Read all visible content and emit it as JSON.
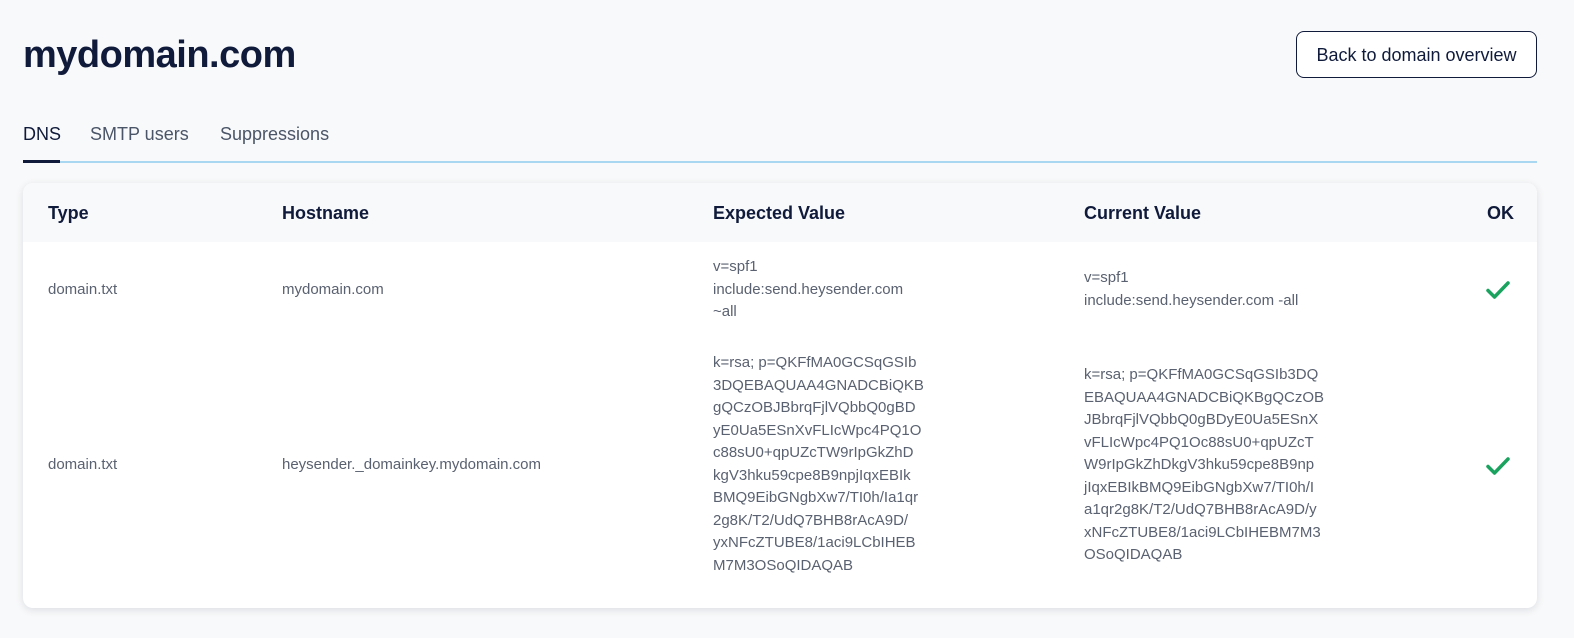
{
  "header": {
    "title": "mydomain.com",
    "back_button_label": "Back to domain overview"
  },
  "tabs": [
    {
      "label": "DNS",
      "active": true
    },
    {
      "label": "SMTP users",
      "active": false
    },
    {
      "label": "Suppressions",
      "active": false
    }
  ],
  "table": {
    "columns": {
      "type": "Type",
      "hostname": "Hostname",
      "expected": "Expected Value",
      "current": "Current Value",
      "ok": "OK"
    },
    "rows": [
      {
        "type": "domain.txt",
        "hostname": "mydomain.com",
        "expected": "v=spf1\ninclude:send.heysender.com\n~all",
        "current": "v=spf1\ninclude:send.heysender.com -all",
        "ok_icon": "checkmark-icon"
      },
      {
        "type": "domain.txt",
        "hostname": "heysender._domainkey.mydomain.com",
        "expected": "k=rsa; p=QKFfMA0GCSqGSIb\n3DQEBAQUAA4GNADCBiQKB\ngQCzOBJBbrqFjlVQbbQ0gBD\nyE0Ua5ESnXvFLIcWpc4PQ1O\nc88sU0+qpUZcTW9rIpGkZhD\nkgV3hku59cpe8B9npjIqxEBIk\nBMQ9EibGNgbXw7/TI0h/Ia1qr\n2g8K/T2/UdQ7BHB8rAcA9D/\nyxNFcZTUBE8/1aci9LCbIHEB\nM7M3OSoQIDAQAB",
        "current": "k=rsa; p=QKFfMA0GCSqGSIb3DQ\nEBAQUAA4GNADCBiQKBgQCzOB\nJBbrqFjlVQbbQ0gBDyE0Ua5ESnX\nvFLIcWpc4PQ1Oc88sU0+qpUZcT\nW9rIpGkZhDkgV3hku59cpe8B9np\njIqxEBIkBMQ9EibGNgbXw7/TI0h/I\na1qr2g8K/T2/UdQ7BHB8rAcA9D/y\nxNFcZTUBE8/1aci9LCbIHEBM7M3\nOSoQIDAQAB",
        "ok_icon": "checkmark-icon"
      }
    ]
  },
  "colors": {
    "ok_green": "#1aa35e",
    "primary": "#101b3b",
    "tab_border": "#a9d6f0"
  }
}
